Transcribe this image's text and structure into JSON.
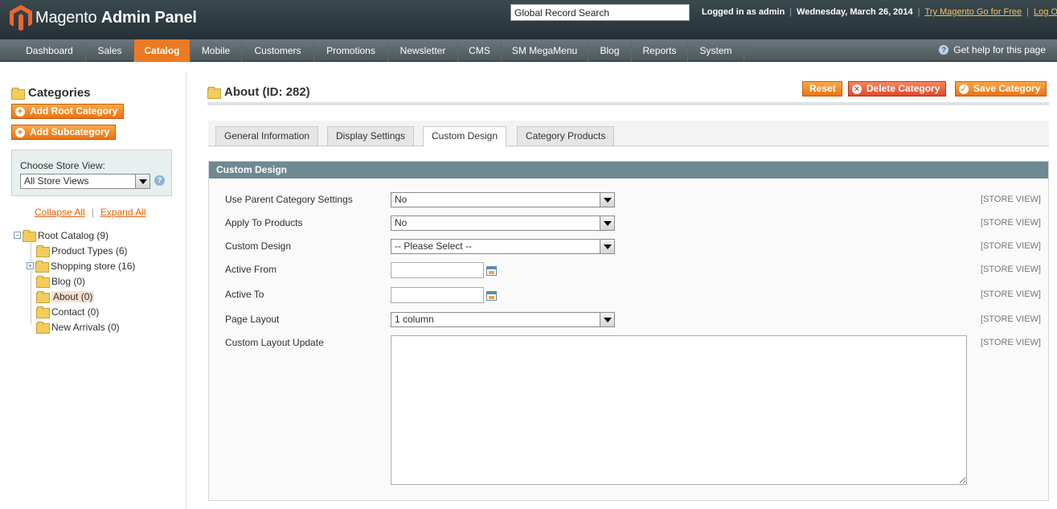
{
  "header": {
    "brand": "Magento",
    "brand_suffix": "Admin Panel",
    "search_value": "Global Record Search",
    "logged_in": "Logged in as admin",
    "date": "Wednesday, March 26, 2014",
    "try_link": "Try Magento Go for Free",
    "logout": "Log Out"
  },
  "nav": {
    "items": [
      "Dashboard",
      "Sales",
      "Catalog",
      "Mobile",
      "Customers",
      "Promotions",
      "Newsletter",
      "CMS",
      "SM MegaMenu",
      "Blog",
      "Reports",
      "System"
    ],
    "active": "Catalog",
    "help": "Get help for this page"
  },
  "sidebar": {
    "title": "Categories",
    "add_root": "Add Root Category",
    "add_sub": "Add Subcategory",
    "store_view_label": "Choose Store View:",
    "store_view_value": "All Store Views",
    "collapse_all": "Collapse All",
    "expand_all": "Expand All",
    "tree": [
      {
        "label": "Root Catalog (9)",
        "level": 0,
        "toggle": "−"
      },
      {
        "label": "Product Types (6)",
        "level": 1
      },
      {
        "label": "Shopping store (16)",
        "level": 1,
        "toggle": "+"
      },
      {
        "label": "Blog (0)",
        "level": 1
      },
      {
        "label": "About (0)",
        "level": 1,
        "selected": true
      },
      {
        "label": "Contact (0)",
        "level": 1
      },
      {
        "label": "New Arrivals (0)",
        "level": 1
      }
    ]
  },
  "main": {
    "title": "About (ID: 282)",
    "reset": "Reset",
    "delete": "Delete Category",
    "save": "Save Category",
    "tabs": [
      "General Information",
      "Display Settings",
      "Custom Design",
      "Category Products"
    ],
    "active_tab": "Custom Design",
    "section_title": "Custom Design",
    "scope": "[STORE VIEW]",
    "fields": {
      "use_parent": {
        "label": "Use Parent Category Settings",
        "value": "No"
      },
      "apply_products": {
        "label": "Apply To Products",
        "value": "No"
      },
      "custom_design": {
        "label": "Custom Design",
        "value": "-- Please Select --"
      },
      "active_from": {
        "label": "Active From",
        "value": ""
      },
      "active_to": {
        "label": "Active To",
        "value": ""
      },
      "page_layout": {
        "label": "Page Layout",
        "value": "1 column"
      },
      "layout_update": {
        "label": "Custom Layout Update",
        "value": ""
      }
    }
  },
  "colors": {
    "accent": "#ec7a22",
    "header": "#2c393e",
    "section": "#6f8992",
    "danger": "#e4462a"
  }
}
